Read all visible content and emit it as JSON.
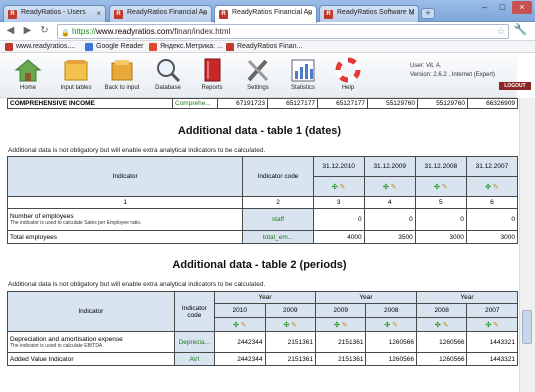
{
  "tabs": [
    {
      "label": "ReadyRatios - Users",
      "favicon": "RR"
    },
    {
      "label": "ReadyRatios Financial An",
      "favicon": "RR"
    },
    {
      "label": "ReadyRatios Financial An",
      "favicon": "RR"
    },
    {
      "label": "ReadyRatios Software M",
      "favicon": "RR"
    }
  ],
  "address": {
    "scheme": "https://",
    "domain": "www.readyratios.com",
    "path": "/finan/index.html"
  },
  "bookmarks": [
    "www.readyratios....",
    "Google Reader",
    "Яндекс.Метрика: ...",
    "ReadyRatios Finan..."
  ],
  "toolbar": [
    "Home",
    "Input tables",
    "Back to input",
    "Database",
    "Reports",
    "Settings",
    "Statistics",
    "Help"
  ],
  "user": {
    "user_label": "User:",
    "user_value": "Vit. A.",
    "version_label": "Version:",
    "version_value": "2.6.2 , Internet (Expert)",
    "logout": "LOGOUT"
  },
  "top_row": {
    "label": "COMPREHENSIVE INCOME",
    "code": "Comprehe...",
    "values": [
      "67191723",
      "65127177",
      "65127177",
      "55129760",
      "55129760",
      "66326909"
    ]
  },
  "table1": {
    "title": "Additional data - table 1 (dates)",
    "note": "Additional data is not obligatory but will enable extra analytical indicators to be calculated.",
    "col_indicator": "Indicator",
    "col_code": "Indicator code",
    "dates": [
      "31.12.2010",
      "31.12.2009",
      "31.12.2008",
      "31.12.2007"
    ],
    "numbers": [
      "1",
      "2",
      "3",
      "4",
      "5",
      "6"
    ],
    "rows": [
      {
        "label": "Number of employees",
        "sub": "The indicator is used to calculate Sales per Employee ratio.",
        "code": "staff",
        "values": [
          "0",
          "0",
          "0",
          "0"
        ]
      },
      {
        "label": "Total employees",
        "sub": "",
        "code": "total_em...",
        "values": [
          "4000",
          "3500",
          "3000",
          "3000"
        ]
      }
    ]
  },
  "table2": {
    "title": "Additional data - table 2 (periods)",
    "note": "Additional data is not obligatory but will enable extra analytical indicators to be calculated.",
    "col_indicator": "Indicator",
    "col_code": "Indicator code",
    "year_label": "Year",
    "years": [
      "2010",
      "2009",
      "2009",
      "2008",
      "2008",
      "2007"
    ],
    "rows": [
      {
        "label": "Depreciation and amortisation expense",
        "sub": "The indicator is used to calculate EBITDA.",
        "code": "Deprecia...",
        "values": [
          "2442344",
          "2151361",
          "2151361",
          "1260566",
          "1260566",
          "1443321"
        ]
      },
      {
        "label": "Added Value Indicator",
        "sub": "",
        "code": "AVI",
        "values": [
          "2442344",
          "2151361",
          "2151361",
          "1260566",
          "1260566",
          "1443321"
        ]
      }
    ]
  },
  "icons": {
    "action_green": "expand-icon",
    "action_orange": "edit-icon"
  }
}
